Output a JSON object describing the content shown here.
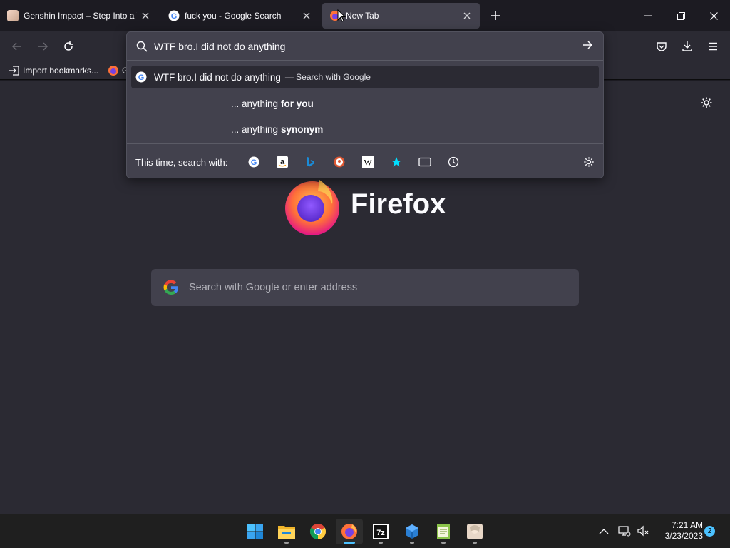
{
  "tabs": [
    {
      "title": "Genshin Impact – Step Into a Vast",
      "icon": "genshin-favicon"
    },
    {
      "title": "fuck you - Google Search",
      "icon": "google-favicon"
    },
    {
      "title": "New Tab",
      "icon": "firefox-favicon",
      "selected": true
    }
  ],
  "bookmarks": [
    {
      "label": "Import bookmarks...",
      "icon": "import-icon"
    },
    {
      "label": "G",
      "icon": "firefox-favicon"
    }
  ],
  "urlbar": {
    "value": "WTF bro.I did not do anything",
    "results": [
      {
        "text": "WTF bro.I did not do anything",
        "action": "— Search with Google",
        "icon": "google-icon"
      },
      {
        "prefix": "... anything ",
        "bold": "for you"
      },
      {
        "prefix": "... anything ",
        "bold": "synonym"
      }
    ],
    "search_with_label": "This time, search with:",
    "engines": [
      "google-icon",
      "amazon-icon",
      "bing-icon",
      "duckduckgo-icon",
      "wikipedia-icon",
      "bookmarks-star-icon",
      "tabs-icon",
      "history-icon"
    ]
  },
  "newtab": {
    "wordmark": "Firefox",
    "search_placeholder": "Search with Google or enter address"
  },
  "taskbar": {
    "apps": [
      "start-icon",
      "file-explorer-icon",
      "chrome-icon",
      "firefox-icon",
      "7zip-icon",
      "cube-app-icon",
      "notepad-icon",
      "genshin-icon"
    ],
    "time": "7:21 AM",
    "date": "3/23/2023",
    "notifications": "2"
  }
}
